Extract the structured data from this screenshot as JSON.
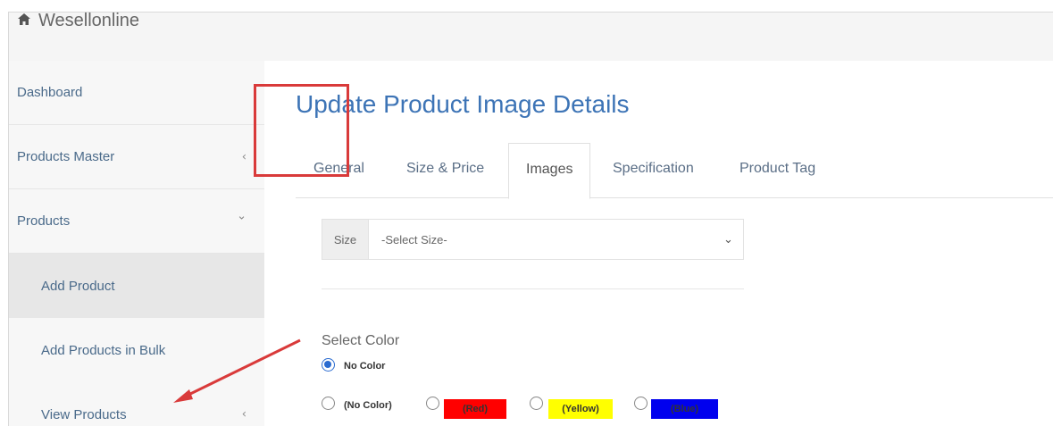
{
  "app": {
    "brand": "Wesellonline"
  },
  "sidebar": {
    "items": [
      {
        "label": "Dashboard",
        "chevron": ""
      },
      {
        "label": "Products Master",
        "chevron": "‹"
      },
      {
        "label": "Products",
        "chevron": "⌄"
      },
      {
        "label": "Add Product",
        "chevron": ""
      },
      {
        "label": "Add Products in Bulk",
        "chevron": ""
      },
      {
        "label": "View Products",
        "chevron": "‹"
      }
    ]
  },
  "main": {
    "title": "Update Product Image Details",
    "tabs": [
      {
        "label": "General"
      },
      {
        "label": "Size & Price"
      },
      {
        "label": "Images"
      },
      {
        "label": "Specification"
      },
      {
        "label": "Product Tag"
      }
    ],
    "size_select": {
      "label": "Size",
      "value": "-Select Size-",
      "arrow": "⌄"
    },
    "color_section": {
      "heading": "Select Color",
      "selected_option": "No Color",
      "options": [
        {
          "label": "(No Color)",
          "bg": ""
        },
        {
          "label": "(Red)",
          "bg": "#ff0000"
        },
        {
          "label": "(Yellow)",
          "bg": "#ffff00"
        },
        {
          "label": "(Blue)",
          "bg": "#0000ee"
        }
      ]
    }
  },
  "colors": {
    "accent": "#3d74b6",
    "highlight_border": "#d93a3a",
    "annotation_arrow": "#d93a3a"
  }
}
